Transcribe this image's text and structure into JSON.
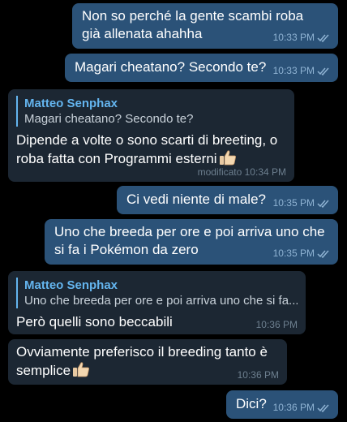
{
  "messages": [
    {
      "text": "Non so perché la gente scambi roba già allenata ahahha",
      "time": "10:33 PM"
    },
    {
      "text": "Magari cheatano? Secondo te?",
      "time": "10:33 PM"
    },
    {
      "reply_author": "Matteo Senphax",
      "reply_text": "Magari cheatano? Secondo te?",
      "text": "Dipende a volte o sono scarti di breeting, o roba fatta con Programmi esterni",
      "emoji": "thumbs-up",
      "time": "modificato 10:34 PM"
    },
    {
      "text": "Ci vedi niente di male?",
      "time": "10:35 PM"
    },
    {
      "text": "Uno che breeda per ore e poi arriva uno che si fa i Pokémon da zero",
      "time": "10:35 PM"
    },
    {
      "reply_author": "Matteo Senphax",
      "reply_text": "Uno che breeda per ore e poi arriva uno che si fa...",
      "text": "Però quelli sono beccabili",
      "time": "10:36 PM"
    },
    {
      "text": "Ovviamente preferisco il breeding tanto è semplice",
      "emoji": "thumbs-up",
      "time": "10:36 PM"
    },
    {
      "text": "Dici?",
      "time": "10:36 PM"
    }
  ],
  "colors": {
    "background": "#000000",
    "outgoing_bubble": "#2b5278",
    "incoming_bubble": "#1c2733",
    "reply_accent": "#64b5ef"
  }
}
